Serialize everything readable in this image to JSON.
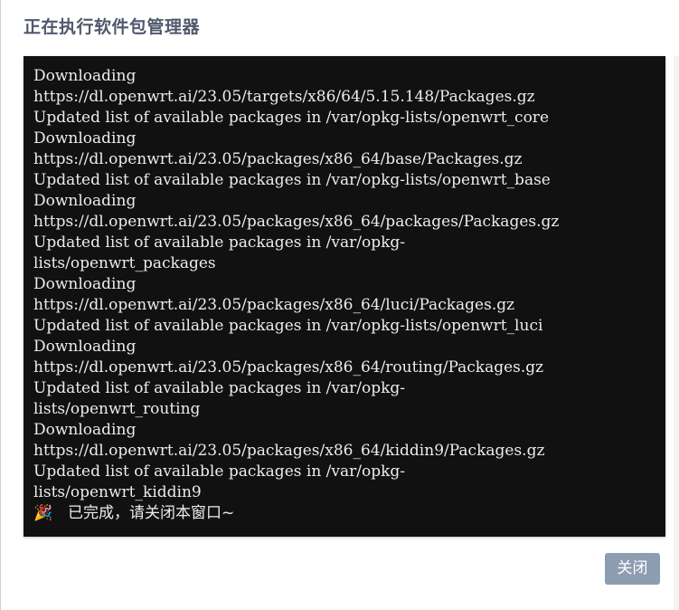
{
  "dialog": {
    "title": "正在执行软件包管理器",
    "close_label": "关闭"
  },
  "console": {
    "lines": [
      "Downloading",
      "https://dl.openwrt.ai/23.05/targets/x86/64/5.15.148/Packages.gz",
      "Updated list of available packages in /var/opkg-lists/openwrt_core",
      "Downloading",
      "https://dl.openwrt.ai/23.05/packages/x86_64/base/Packages.gz",
      "Updated list of available packages in /var/opkg-lists/openwrt_base",
      "Downloading",
      "https://dl.openwrt.ai/23.05/packages/x86_64/packages/Packages.gz",
      "Updated list of available packages in /var/opkg-",
      "lists/openwrt_packages",
      "Downloading",
      "https://dl.openwrt.ai/23.05/packages/x86_64/luci/Packages.gz",
      "Updated list of available packages in /var/opkg-lists/openwrt_luci",
      "Downloading",
      "https://dl.openwrt.ai/23.05/packages/x86_64/routing/Packages.gz",
      "Updated list of available packages in /var/opkg-",
      "lists/openwrt_routing",
      "Downloading",
      "https://dl.openwrt.ai/23.05/packages/x86_64/kiddin9/Packages.gz",
      "Updated list of available packages in /var/opkg-",
      "lists/openwrt_kiddin9"
    ],
    "done_icon": "party-popper-icon",
    "done_text": "已完成，请关闭本窗口~"
  }
}
